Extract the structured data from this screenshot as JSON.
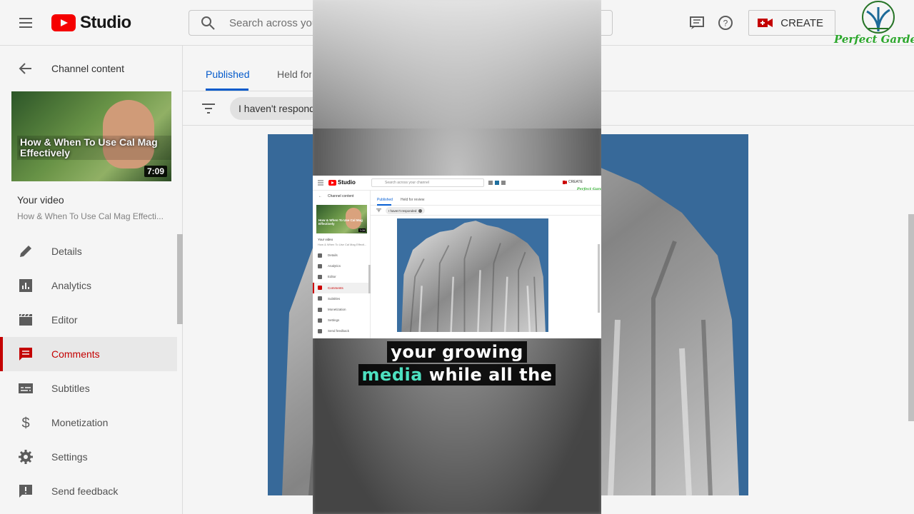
{
  "header": {
    "app_name": "Studio",
    "search_placeholder": "Search across your channel",
    "create_label": "CREATE",
    "brand_name": "Perfect Gardens"
  },
  "sidebar": {
    "back_label": "Channel content",
    "thumbnail_title": "How & When To Use Cal Mag Effectively",
    "thumbnail_duration": "7:09",
    "your_video_label": "Your video",
    "video_title": "How & When To Use Cal Mag Effecti...",
    "items": [
      {
        "label": "Details",
        "icon": "pencil-icon"
      },
      {
        "label": "Analytics",
        "icon": "analytics-icon"
      },
      {
        "label": "Editor",
        "icon": "clapperboard-icon"
      },
      {
        "label": "Comments",
        "icon": "comment-icon",
        "active": true
      },
      {
        "label": "Subtitles",
        "icon": "subtitles-icon"
      },
      {
        "label": "Monetization",
        "icon": "dollar-icon"
      },
      {
        "label": "Settings",
        "icon": "gear-icon"
      },
      {
        "label": "Send feedback",
        "icon": "feedback-icon"
      }
    ]
  },
  "main": {
    "tabs": [
      {
        "label": "Published",
        "active": true
      },
      {
        "label": "Held for review"
      }
    ],
    "filter_chip": "I haven't responded"
  },
  "caption": {
    "line1": "your growing",
    "line2_highlight": "media",
    "line2_rest": "while all the"
  },
  "colors": {
    "accent_red": "#cc0000",
    "accent_blue": "#065fd4",
    "caption_highlight": "#4de0c0",
    "brand_green": "#2eae2e"
  }
}
